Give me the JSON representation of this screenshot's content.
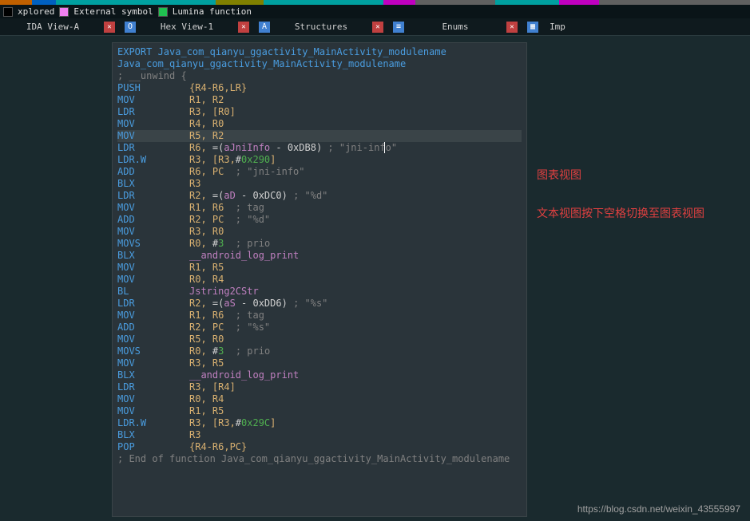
{
  "legend": [
    {
      "label": "xplored",
      "color": "#000000"
    },
    {
      "label": "External symbol",
      "color": "#f080f0"
    },
    {
      "label": "Lumina function",
      "color": "#20c050"
    }
  ],
  "tabs": [
    {
      "label": "IDA View-A",
      "icon_bg": "#4080d0",
      "icon": "▦"
    },
    {
      "label": "Hex View-1",
      "icon_bg": "#4080d0",
      "icon": "O"
    },
    {
      "label": "Structures",
      "icon_bg": "#4080d0",
      "icon": "A"
    },
    {
      "label": "Enums",
      "icon_bg": "#4080d0",
      "icon": "≡"
    },
    {
      "label": "Imp",
      "icon_bg": "#4080d0",
      "icon": "▦"
    }
  ],
  "export_line": "EXPORT Java_com_qianyu_ggactivity_MainActivity_modulename",
  "symbol_line": "Java_com_qianyu_ggactivity_MainActivity_modulename",
  "unwind_line": "; __unwind {",
  "end_line": "; End of function Java_com_qianyu_ggactivity_MainActivity_modulename",
  "asm": [
    {
      "m": "PUSH",
      "ops": [
        {
          "t": "reg",
          "v": "{R4-R6,LR}"
        }
      ]
    },
    {
      "m": "MOV",
      "ops": [
        {
          "t": "reg",
          "v": "R1, R2"
        }
      ]
    },
    {
      "m": "LDR",
      "ops": [
        {
          "t": "reg",
          "v": "R3, [R0]"
        }
      ]
    },
    {
      "m": "MOV",
      "ops": [
        {
          "t": "reg",
          "v": "R4, R0"
        }
      ]
    },
    {
      "m": "MOV",
      "ops": [
        {
          "t": "reg",
          "v": "R5, R2"
        }
      ],
      "hl": true
    },
    {
      "m": "LDR",
      "ops": [
        {
          "t": "reg",
          "v": "R6, "
        },
        {
          "t": "plain",
          "v": "=("
        },
        {
          "t": "ref",
          "v": "aJniInfo"
        },
        {
          "t": "plain",
          "v": " - 0xDB8) "
        },
        {
          "t": "comment",
          "v": "; \"jni-info\""
        }
      ]
    },
    {
      "m": "LDR.W",
      "ops": [
        {
          "t": "reg",
          "v": "R3, [R3,"
        },
        {
          "t": "plain",
          "v": "#"
        },
        {
          "t": "num",
          "v": "0x290"
        },
        {
          "t": "reg",
          "v": "]"
        }
      ]
    },
    {
      "m": "ADD",
      "ops": [
        {
          "t": "reg",
          "v": "R6, PC  "
        },
        {
          "t": "comment",
          "v": "; \"jni-info\""
        }
      ]
    },
    {
      "m": "BLX",
      "ops": [
        {
          "t": "reg",
          "v": "R3"
        }
      ]
    },
    {
      "m": "LDR",
      "ops": [
        {
          "t": "reg",
          "v": "R2, "
        },
        {
          "t": "plain",
          "v": "=("
        },
        {
          "t": "ref",
          "v": "aD"
        },
        {
          "t": "plain",
          "v": " - 0xDC0) "
        },
        {
          "t": "comment",
          "v": "; \"%d\""
        }
      ]
    },
    {
      "m": "MOV",
      "ops": [
        {
          "t": "reg",
          "v": "R1, R6  "
        },
        {
          "t": "comment",
          "v": "; tag"
        }
      ]
    },
    {
      "m": "ADD",
      "ops": [
        {
          "t": "reg",
          "v": "R2, PC  "
        },
        {
          "t": "comment",
          "v": "; \"%d\""
        }
      ]
    },
    {
      "m": "MOV",
      "ops": [
        {
          "t": "reg",
          "v": "R3, R0"
        }
      ]
    },
    {
      "m": "MOVS",
      "ops": [
        {
          "t": "reg",
          "v": "R0, "
        },
        {
          "t": "plain",
          "v": "#"
        },
        {
          "t": "num",
          "v": "3"
        },
        {
          "t": "reg",
          "v": "  "
        },
        {
          "t": "comment",
          "v": "; prio"
        }
      ]
    },
    {
      "m": "BLX",
      "ops": [
        {
          "t": "func",
          "v": "__android_log_print"
        }
      ]
    },
    {
      "m": "MOV",
      "ops": [
        {
          "t": "reg",
          "v": "R1, R5"
        }
      ]
    },
    {
      "m": "MOV",
      "ops": [
        {
          "t": "reg",
          "v": "R0, R4"
        }
      ]
    },
    {
      "m": "BL",
      "ops": [
        {
          "t": "func",
          "v": "Jstring2CStr"
        }
      ]
    },
    {
      "m": "LDR",
      "ops": [
        {
          "t": "reg",
          "v": "R2, "
        },
        {
          "t": "plain",
          "v": "=("
        },
        {
          "t": "ref",
          "v": "aS"
        },
        {
          "t": "plain",
          "v": " - 0xDD6) "
        },
        {
          "t": "comment",
          "v": "; \"%s\""
        }
      ]
    },
    {
      "m": "MOV",
      "ops": [
        {
          "t": "reg",
          "v": "R1, R6  "
        },
        {
          "t": "comment",
          "v": "; tag"
        }
      ]
    },
    {
      "m": "ADD",
      "ops": [
        {
          "t": "reg",
          "v": "R2, PC  "
        },
        {
          "t": "comment",
          "v": "; \"%s\""
        }
      ]
    },
    {
      "m": "MOV",
      "ops": [
        {
          "t": "reg",
          "v": "R5, R0"
        }
      ]
    },
    {
      "m": "MOVS",
      "ops": [
        {
          "t": "reg",
          "v": "R0, "
        },
        {
          "t": "plain",
          "v": "#"
        },
        {
          "t": "num",
          "v": "3"
        },
        {
          "t": "reg",
          "v": "  "
        },
        {
          "t": "comment",
          "v": "; prio"
        }
      ]
    },
    {
      "m": "MOV",
      "ops": [
        {
          "t": "reg",
          "v": "R3, R5"
        }
      ]
    },
    {
      "m": "BLX",
      "ops": [
        {
          "t": "func",
          "v": "__android_log_print"
        }
      ]
    },
    {
      "m": "LDR",
      "ops": [
        {
          "t": "reg",
          "v": "R3, [R4]"
        }
      ]
    },
    {
      "m": "MOV",
      "ops": [
        {
          "t": "reg",
          "v": "R0, R4"
        }
      ]
    },
    {
      "m": "MOV",
      "ops": [
        {
          "t": "reg",
          "v": "R1, R5"
        }
      ]
    },
    {
      "m": "LDR.W",
      "ops": [
        {
          "t": "reg",
          "v": "R3, [R3,"
        },
        {
          "t": "plain",
          "v": "#"
        },
        {
          "t": "num",
          "v": "0x29C"
        },
        {
          "t": "reg",
          "v": "]"
        }
      ]
    },
    {
      "m": "BLX",
      "ops": [
        {
          "t": "reg",
          "v": "R3"
        }
      ]
    },
    {
      "m": "POP",
      "ops": [
        {
          "t": "reg",
          "v": "{R4-R6,PC}"
        }
      ]
    }
  ],
  "annotations": {
    "line1": "图表视图",
    "line2": "文本视图按下空格切换至图表视图"
  },
  "watermark": "https://blog.csdn.net/weixin_43555997"
}
